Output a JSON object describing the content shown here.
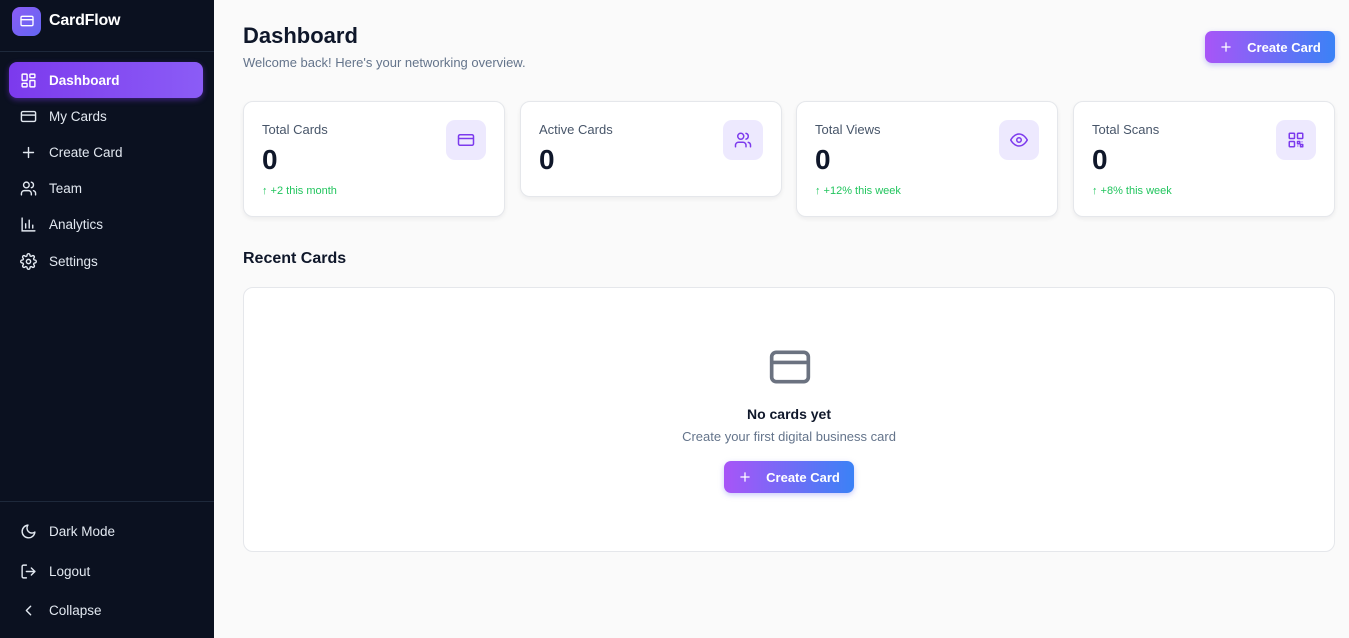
{
  "brand": {
    "name": "CardFlow",
    "logo_icon": "card-icon",
    "accent": "#8b5cf6"
  },
  "sidebar": {
    "items": [
      {
        "label": "Dashboard",
        "icon": "dashboard-icon",
        "active": true
      },
      {
        "label": "My Cards",
        "icon": "card-icon"
      },
      {
        "label": "Create Card",
        "icon": "plus-icon"
      },
      {
        "label": "Team",
        "icon": "users-icon"
      },
      {
        "label": "Analytics",
        "icon": "bar-chart-icon"
      },
      {
        "label": "Settings",
        "icon": "gear-icon"
      }
    ],
    "bottom": [
      {
        "label": "Dark Mode",
        "icon": "moon-icon"
      },
      {
        "label": "Logout",
        "icon": "logout-icon"
      },
      {
        "label": "Collapse",
        "icon": "chevron-left-icon"
      }
    ]
  },
  "header": {
    "title": "Dashboard",
    "subtitle": "Welcome back! Here's your networking overview.",
    "create_label": "Create Card"
  },
  "stats": [
    {
      "label": "Total Cards",
      "value": "0",
      "change": "↑ +2 this month",
      "icon": "card-icon"
    },
    {
      "label": "Active Cards",
      "value": "0",
      "change": "",
      "icon": "users-icon"
    },
    {
      "label": "Total Views",
      "value": "0",
      "change": "↑ +12% this week",
      "icon": "eye-icon"
    },
    {
      "label": "Total Scans",
      "value": "0",
      "change": "↑ +8% this week",
      "icon": "qr-code-icon"
    }
  ],
  "recent": {
    "title": "Recent Cards",
    "empty_title": "No cards yet",
    "empty_text": "Create your first digital business card",
    "create_label": "Create Card"
  },
  "colors": {
    "sidebar_bg": "#0b1120",
    "positive": "#22c55e",
    "gradient_start": "#a855f7",
    "gradient_end": "#3b82f6"
  }
}
